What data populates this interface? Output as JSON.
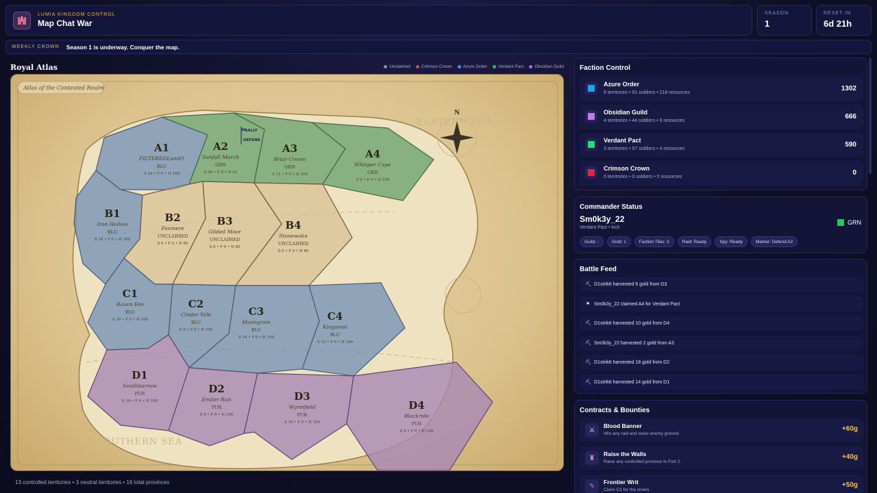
{
  "header": {
    "subtitle": "Lumia Kingdom Control",
    "title": "Map Chat War",
    "app_icon": "castle-icon",
    "season_label": "Season",
    "season_value": "1",
    "reset_label": "Reset In",
    "reset_value": "6d 21h"
  },
  "banner": {
    "label": "Weekly Crown",
    "text": "Season 1 is underway. Conquer the map."
  },
  "atlas": {
    "title": "Royal Atlas",
    "map_caption": "Atlas of the Contested Realm",
    "compass_label": "N",
    "sea_east": "EASTERN SEA",
    "sea_south": "SOUTHERN SEA",
    "legend": [
      {
        "label": "Unclaimed",
        "color": "#8b8d9e"
      },
      {
        "label": "Crimson Crown",
        "color": "#e0434f"
      },
      {
        "label": "Azure Order",
        "color": "#4a8fe0"
      },
      {
        "label": "Verdant Pact",
        "color": "#22c55e"
      },
      {
        "label": "Obsidian Guild",
        "color": "#b566e0"
      }
    ],
    "marker_rally": "RALLY",
    "marker_defend": "DEFEND",
    "territories": [
      {
        "id": "A1",
        "name": "FILTEREDLandO",
        "owner": "BLU",
        "stats": "S 24 • F 0 • H 100"
      },
      {
        "id": "A2",
        "name": "Sunfall March",
        "owner": "GRN",
        "stats": "S 46 • F 0 • H 92"
      },
      {
        "id": "A3",
        "name": "Briar Crown",
        "owner": "GRN",
        "stats": "S 11 • F 0 • H 100"
      },
      {
        "id": "A4",
        "name": "Whisper Cape",
        "owner": "GRN",
        "stats": "S 0 • F 0 • H 100"
      },
      {
        "id": "B1",
        "name": "Iron Hollow",
        "owner": "BLU",
        "stats": "S 16 • F 0 • H 100"
      },
      {
        "id": "B2",
        "name": "Foxmere",
        "owner": "UNCLAIMED",
        "stats": "S 0 • F 0 • H 80"
      },
      {
        "id": "B3",
        "name": "Gilded Moor",
        "owner": "UNCLAIMED",
        "stats": "S 0 • F 0 • H 80"
      },
      {
        "id": "B4",
        "name": "Stonewake",
        "owner": "UNCLAIMED",
        "stats": "S 0 • F 0 • H 80"
      },
      {
        "id": "C1",
        "name": "Raven Fen",
        "owner": "BLU",
        "stats": "S 16 • F 0 • H 100"
      },
      {
        "id": "C2",
        "name": "Cinder Vale",
        "owner": "BLU",
        "stats": "S 6 • F 0 • H 100"
      },
      {
        "id": "C3",
        "name": "Moongrain",
        "owner": "BLU",
        "stats": "S 16 • F 0 • H 100"
      },
      {
        "id": "C4",
        "name": "Kingsrest",
        "owner": "BLU",
        "stats": "S 13 • F 0 • H 100"
      },
      {
        "id": "D1",
        "name": "Southbarrow",
        "owner": "PUR",
        "stats": "S 16 • F 0 • H 100"
      },
      {
        "id": "D2",
        "name": "Ember Run",
        "owner": "PUR",
        "stats": "S 6 • F 0 • H 100"
      },
      {
        "id": "D3",
        "name": "Wyrmfield",
        "owner": "PUR",
        "stats": "S 16 • F 0 • H 100"
      },
      {
        "id": "D4",
        "name": "Blackride",
        "owner": "PUR",
        "stats": "S 6 • F 0 • H 100"
      }
    ],
    "footer": "13 controlled territories • 3 neutral territories • 16 total provinces"
  },
  "factions": {
    "title": "Faction Control",
    "items": [
      {
        "name": "Azure Order",
        "meta": "6 territories • 91 soldiers • 218 resources",
        "score": "1302",
        "color": "#1aa3e8"
      },
      {
        "name": "Obsidian Guild",
        "meta": "4 territories • 44 soldiers • 6 resources",
        "score": "666",
        "color": "#c27ae8"
      },
      {
        "name": "Verdant Pact",
        "meta": "3 territories • 57 soldiers • 4 resources",
        "score": "590",
        "color": "#22e06b"
      },
      {
        "name": "Crimson Crown",
        "meta": "0 territories • 0 soldiers • 0 resources",
        "score": "0",
        "color": "#e0283a"
      }
    ]
  },
  "commander": {
    "title": "Commander Status",
    "name": "Sm0k3y_22",
    "sub": "Verdant Pact • kick",
    "badge": "GRN",
    "chips": [
      "Guild: -",
      "Gold: 1",
      "Faction Tiles: 3",
      "Raid: Ready",
      "Spy: Ready",
      "Marker: Defend A2"
    ]
  },
  "feed": {
    "title": "Battle Feed",
    "items": [
      {
        "icon": "pickaxe-icon",
        "glyph": "⛏",
        "text": "D1striktt harvested 6 gold from D3"
      },
      {
        "icon": "flag-icon",
        "glyph": "⚑",
        "text": "Sm0k3y_22 claimed A4 for Verdant Pact"
      },
      {
        "icon": "pickaxe-icon",
        "glyph": "⛏",
        "text": "D1striktt harvested 10 gold from D4"
      },
      {
        "icon": "pickaxe-icon",
        "glyph": "⛏",
        "text": "Sm0k3y_22 harvested 2 gold from A3"
      },
      {
        "icon": "pickaxe-icon",
        "glyph": "⛏",
        "text": "D1striktt harvested 18 gold from D2"
      },
      {
        "icon": "pickaxe-icon",
        "glyph": "⛏",
        "text": "D1striktt harvested 14 gold from D1"
      }
    ]
  },
  "bounties": {
    "title": "Contracts & Bounties",
    "items": [
      {
        "icon": "crossed-swords-icon",
        "glyph": "⚔",
        "name": "Blood Banner",
        "desc": "Win any raid and seize enemy ground.",
        "reward": "+60g"
      },
      {
        "icon": "castle-icon",
        "glyph": "♜",
        "name": "Raise the Walls",
        "desc": "Raise any controlled province to Fort 2.",
        "reward": "+40g"
      },
      {
        "icon": "scroll-pin-icon",
        "glyph": "✎",
        "name": "Frontier Writ",
        "desc": "Claim C2 for the crown.",
        "reward": "+50g"
      }
    ]
  }
}
